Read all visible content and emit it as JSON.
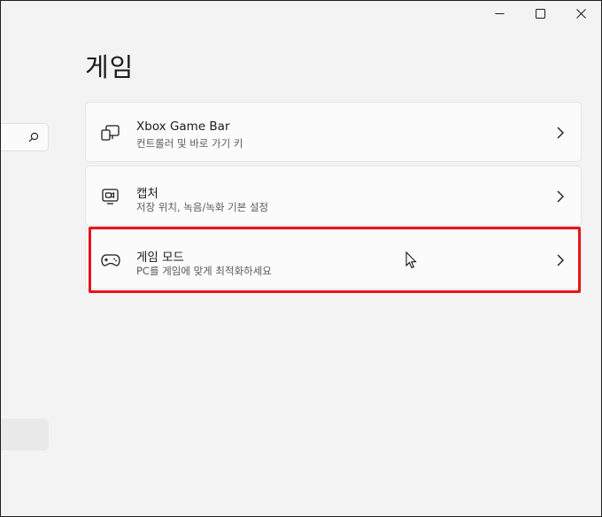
{
  "window": {
    "minimize_icon": "minimize-icon",
    "maximize_icon": "maximize-icon",
    "close_icon": "close-icon"
  },
  "sidebar": {
    "search_icon": "search-icon"
  },
  "page": {
    "title": "게임"
  },
  "cards": [
    {
      "title": "Xbox Game Bar",
      "subtitle": "컨트롤러 및 바로 가기 키",
      "icon": "game-bar-icon"
    },
    {
      "title": "캡처",
      "subtitle": "저장 위치, 녹음/녹화 기본 설정",
      "icon": "capture-icon"
    },
    {
      "title": "게임 모드",
      "subtitle": "PC를 게임에 맞게 최적화하세요",
      "icon": "gamepad-icon"
    }
  ],
  "colors": {
    "highlight": "#e8141c",
    "background": "#f3f3f3",
    "card": "#fbfbfb"
  }
}
